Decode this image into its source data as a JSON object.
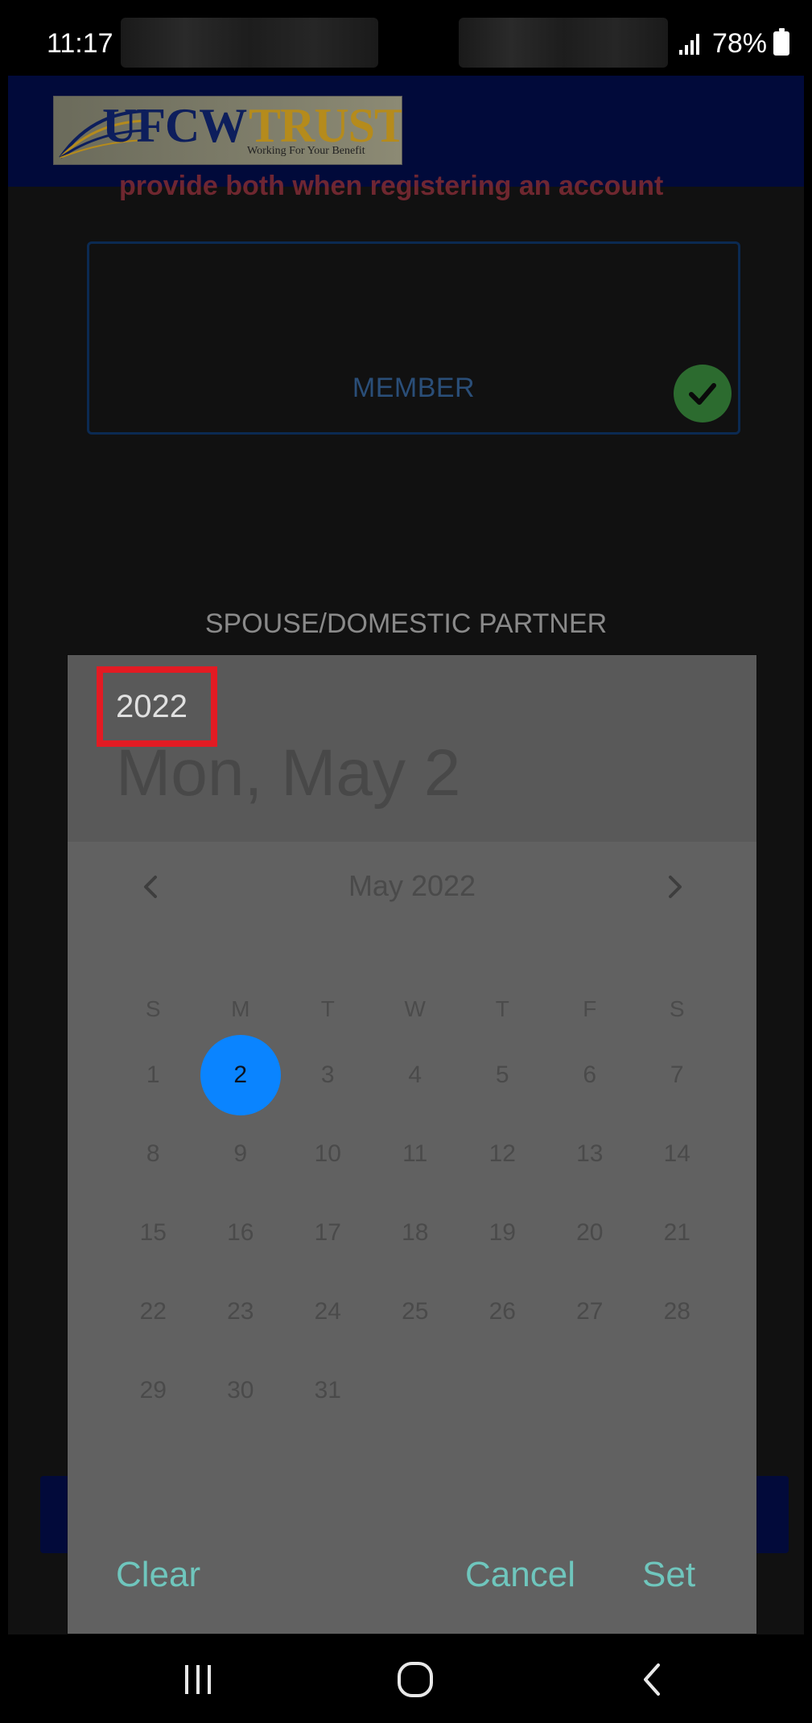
{
  "status_bar": {
    "time": "11:17",
    "battery": "78%",
    "icons": [
      "signal-icon",
      "battery-icon"
    ]
  },
  "app": {
    "logo": {
      "part_a": "UFCW",
      "part_b": "TRUST",
      "tagline": "Working For Your Benefit"
    },
    "clipped_text": "provide both when registering an account",
    "member_label": "MEMBER",
    "spouse_label": "SPOUSE/DOMESTIC PARTNER"
  },
  "date_picker": {
    "year": "2022",
    "selected_date_label": "Mon, May 2",
    "month_label": "May 2022",
    "weekdays": [
      "S",
      "M",
      "T",
      "W",
      "T",
      "F",
      "S"
    ],
    "weeks": [
      [
        "1",
        "2",
        "3",
        "4",
        "5",
        "6",
        "7"
      ],
      [
        "8",
        "9",
        "10",
        "11",
        "12",
        "13",
        "14"
      ],
      [
        "15",
        "16",
        "17",
        "18",
        "19",
        "20",
        "21"
      ],
      [
        "22",
        "23",
        "24",
        "25",
        "26",
        "27",
        "28"
      ],
      [
        "29",
        "30",
        "31",
        "",
        "",
        "",
        ""
      ]
    ],
    "selected_day": "2",
    "buttons": {
      "clear": "Clear",
      "cancel": "Cancel",
      "set": "Set"
    }
  },
  "colors": {
    "accent_button": "#6fc6bd",
    "selected_day": "#0a84ff",
    "highlight_box": "#e31b23",
    "header_bar": "#010a3a"
  }
}
